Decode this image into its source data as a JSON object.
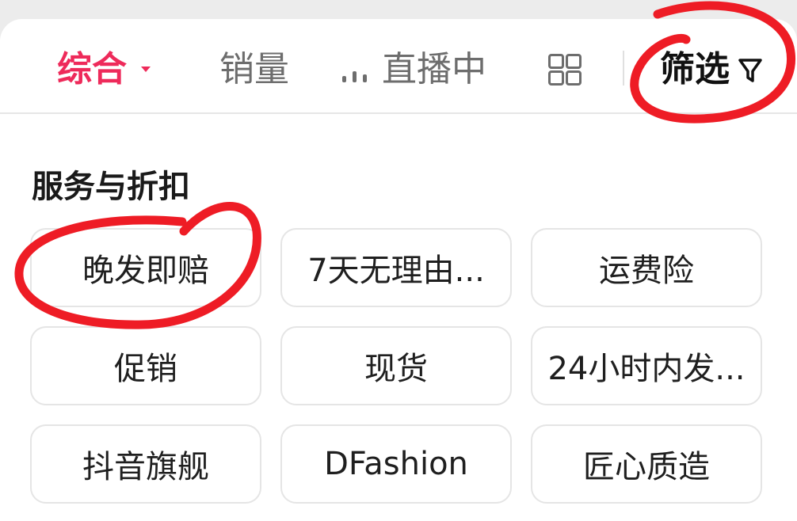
{
  "sort_bar": {
    "comprehensive": "综合",
    "sales": "销量",
    "live": "直播中",
    "filter": "筛选"
  },
  "section": {
    "title": "服务与折扣"
  },
  "tags": [
    "晚发即赔",
    "7天无理由...",
    "运费险",
    "促销",
    "现货",
    "24小时内发...",
    "抖音旗舰",
    "DFashion",
    "匠心质造"
  ],
  "colors": {
    "accent": "#ee2a5a",
    "annotation": "#ee1c25"
  },
  "icons": [
    "caret-down-icon",
    "live-bars-icon",
    "grid-view-icon",
    "filter-funnel-icon"
  ]
}
